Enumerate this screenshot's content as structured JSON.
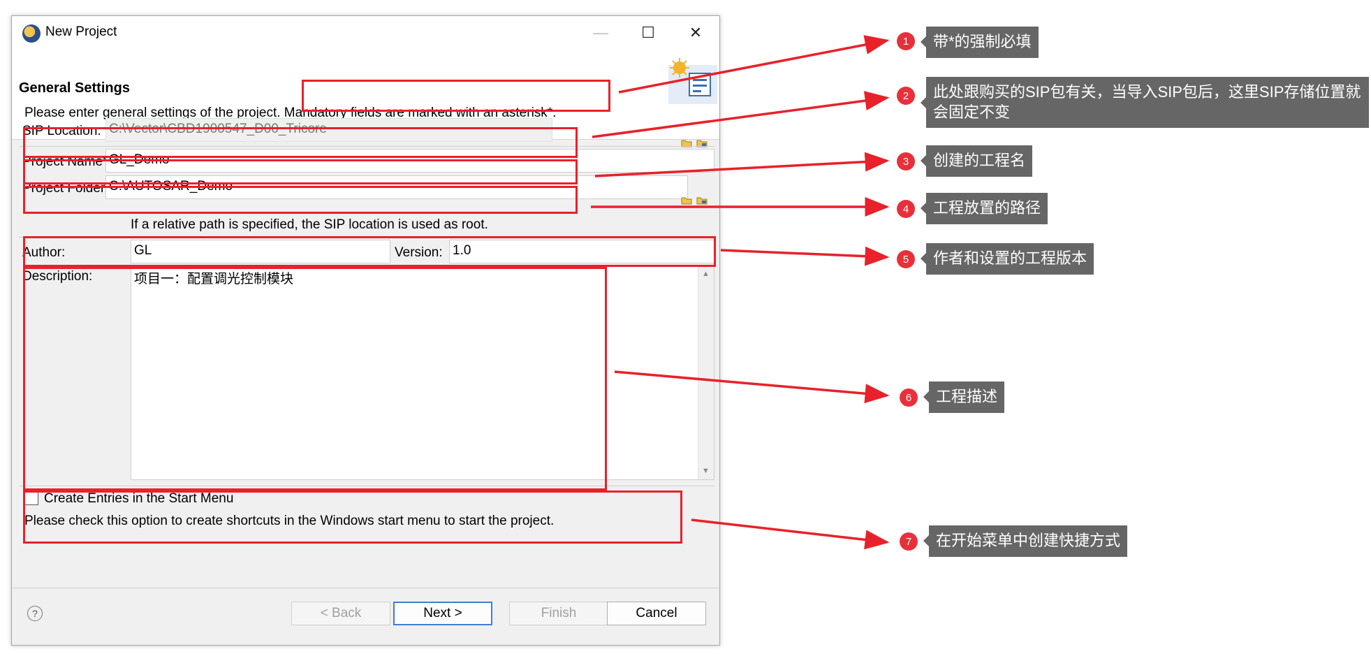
{
  "window": {
    "title": "New Project",
    "controls": {
      "minimize": "—",
      "maximize": "☐",
      "close": "✕"
    }
  },
  "header": {
    "title": "General Settings",
    "desc_prefix": "Please enter general settings of the project.",
    "desc_mandatory": "Mandatory fields are marked with an asterisk*."
  },
  "form": {
    "sip_label": "SIP Location:",
    "sip_value": "C:\\Vector\\CBD1900547_D00_Tricore",
    "name_label": "Project Name*:",
    "name_value": "GL_Demo",
    "folder_label": "Project Folder*:",
    "folder_value": "C:\\AUTOSAR_Demo",
    "folder_hint": "If a relative path is specified, the SIP location is used as root.",
    "author_label": "Author:",
    "author_value": "GL",
    "version_label": "Version:",
    "version_value": "1.0",
    "description_label": "Description:",
    "description_value": "项目一：配置调光控制模块",
    "start_menu_label": "Create Entries in the Start Menu",
    "start_menu_checked": false,
    "start_menu_hint": "Please check this option to create shortcuts in the Windows start menu to start the project."
  },
  "buttons": {
    "help": "?",
    "back": "< Back",
    "next": "Next >",
    "finish": "Finish",
    "cancel": "Cancel"
  },
  "annotations": [
    {
      "num": "1",
      "text": "带*的强制必填"
    },
    {
      "num": "2",
      "text": "此处跟购买的SIP包有关，当导入SIP包后，这里SIP存储位置就会固定不变"
    },
    {
      "num": "3",
      "text": "创建的工程名"
    },
    {
      "num": "4",
      "text": "工程放置的路径"
    },
    {
      "num": "5",
      "text": "作者和设置的工程版本"
    },
    {
      "num": "6",
      "text": "工程描述"
    },
    {
      "num": "7",
      "text": "在开始菜单中创建快捷方式"
    }
  ],
  "colors": {
    "annotation_red": "#e8212a",
    "note_background": "#666666",
    "default_button_border": "#3b7fd6"
  }
}
